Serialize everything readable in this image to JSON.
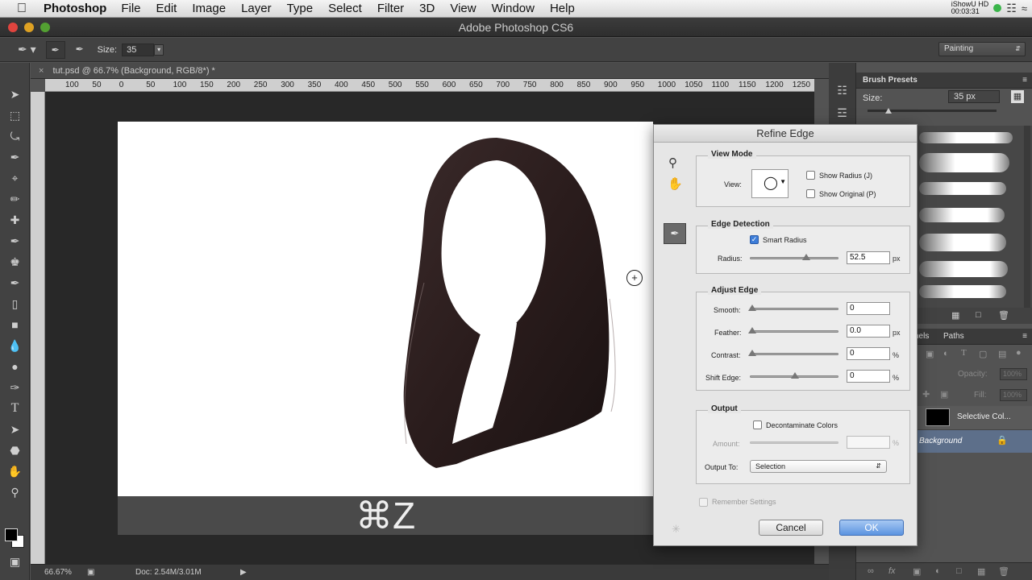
{
  "menubar": {
    "app": "Photoshop",
    "items": [
      "File",
      "Edit",
      "Image",
      "Layer",
      "Type",
      "Select",
      "Filter",
      "3D",
      "View",
      "Window",
      "Help"
    ],
    "status_title": "iShowU HD",
    "status_time": "00:03:31"
  },
  "window": {
    "title": "Adobe Photoshop CS6"
  },
  "options": {
    "size_label": "Size:",
    "size_value": "35",
    "workspace": "Painting"
  },
  "document": {
    "tab_title": "tut.psd @ 66.7% (Background, RGB/8*) *",
    "ruler_h": [
      "100",
      "50",
      "0",
      "50",
      "100",
      "150",
      "200",
      "250",
      "300",
      "350",
      "400",
      "450",
      "500",
      "550",
      "600",
      "650",
      "700",
      "750",
      "800",
      "850",
      "900",
      "950",
      "1000",
      "1050",
      "1100",
      "1150",
      "1200",
      "1250"
    ],
    "zoom": "66.67%",
    "doc_size": "Doc: 2.54M/3.01M"
  },
  "overlay": {
    "keys": "⌘Z"
  },
  "brush_presets": {
    "title": "Brush Presets",
    "size_label": "Size:",
    "size_value": "35 px"
  },
  "layers": {
    "tabs": [
      "nels",
      "Paths"
    ],
    "opacity_label": "Opacity:",
    "opacity_value": "100%",
    "fill_label": "Fill:",
    "fill_value": "100%",
    "items": [
      {
        "name": "Selective Col..."
      },
      {
        "name": "Background"
      }
    ]
  },
  "dialog": {
    "title": "Refine Edge",
    "view_mode": {
      "legend": "View Mode",
      "view_label": "View:",
      "show_radius": "Show Radius (J)",
      "show_original": "Show Original (P)"
    },
    "edge_detection": {
      "legend": "Edge Detection",
      "smart_radius": "Smart Radius",
      "radius_label": "Radius:",
      "radius_value": "52.5",
      "radius_unit": "px"
    },
    "adjust_edge": {
      "legend": "Adjust Edge",
      "smooth_label": "Smooth:",
      "smooth_value": "0",
      "feather_label": "Feather:",
      "feather_value": "0.0",
      "feather_unit": "px",
      "contrast_label": "Contrast:",
      "contrast_value": "0",
      "contrast_unit": "%",
      "shift_label": "Shift Edge:",
      "shift_value": "0",
      "shift_unit": "%"
    },
    "output": {
      "legend": "Output",
      "decontaminate": "Decontaminate Colors",
      "amount_label": "Amount:",
      "amount_unit": "%",
      "output_to_label": "Output To:",
      "output_to_value": "Selection"
    },
    "remember": "Remember Settings",
    "cancel": "Cancel",
    "ok": "OK"
  }
}
